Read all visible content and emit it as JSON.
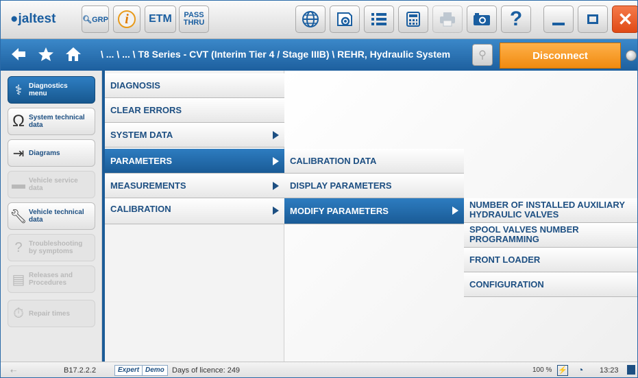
{
  "toolbar": {
    "logo_text": "jaltest",
    "grp_label": "GRP",
    "etm_label": "ETM",
    "pass_thru_line1": "PASS",
    "pass_thru_line2": "THRU",
    "icons": [
      "web-icon",
      "eye-icon",
      "list-icon",
      "calculator-icon",
      "print-icon",
      "camera-icon",
      "help-icon",
      "minimize-icon",
      "maximize-icon",
      "close-icon"
    ],
    "help_label": "?"
  },
  "navbar": {
    "breadcrumb": "\\ ... \\ ... \\ T8 Series - CVT (Interim Tier 4 / Stage IIIB) \\ REHR, Hydraulic System",
    "disconnect_label": "Disconnect"
  },
  "sidebar": {
    "items": [
      {
        "label_line1": "Diagnostics",
        "label_line2": "menu",
        "icon": "stethoscope-icon",
        "active": true
      },
      {
        "label_line1": "System technical",
        "label_line2": "data",
        "icon": "omega-icon",
        "active": false
      },
      {
        "label_line1": "Diagrams",
        "label_line2": "",
        "icon": "diagram-icon",
        "active": false
      },
      {
        "label_line1": "Vehicle service",
        "label_line2": "data",
        "icon": "oil-can-icon",
        "disabled": true
      },
      {
        "label_line1": "Vehicle technical",
        "label_line2": "data",
        "icon": "wrench-gear-icon",
        "active": false
      },
      {
        "label_line1": "Troubleshooting",
        "label_line2": "by symptoms",
        "icon": "question-wrench-icon",
        "disabled": true
      },
      {
        "label_line1": "Releases and",
        "label_line2": "Procedures",
        "icon": "document-gear-icon",
        "disabled": true
      },
      {
        "label_line1": "Repair times",
        "label_line2": "",
        "icon": "stopwatch-icon",
        "disabled": true
      }
    ]
  },
  "menu1": {
    "items": [
      "DIAGNOSIS",
      "CLEAR ERRORS",
      "SYSTEM DATA",
      "PARAMETERS",
      "MEASUREMENTS",
      "CALIBRATION"
    ],
    "selected": "PARAMETERS"
  },
  "menu2": {
    "items": [
      "CALIBRATION DATA",
      "DISPLAY PARAMETERS",
      "MODIFY PARAMETERS"
    ],
    "selected": "MODIFY PARAMETERS"
  },
  "menu3": {
    "items": [
      {
        "line1": "NUMBER OF INSTALLED AUXILIARY",
        "line2": "HYDRAULIC VALVES"
      },
      {
        "line1": "SPOOL VALVES NUMBER",
        "line2": "PROGRAMMING"
      },
      {
        "line1": "FRONT LOADER",
        "line2": ""
      },
      {
        "line1": "CONFIGURATION",
        "line2": ""
      }
    ]
  },
  "status": {
    "version": "B17.2.2.2",
    "mode_expert": "Expert",
    "mode_demo": "Demo",
    "licence": "Days of licence: 249",
    "zoom": "100 %",
    "time": "13:23"
  }
}
